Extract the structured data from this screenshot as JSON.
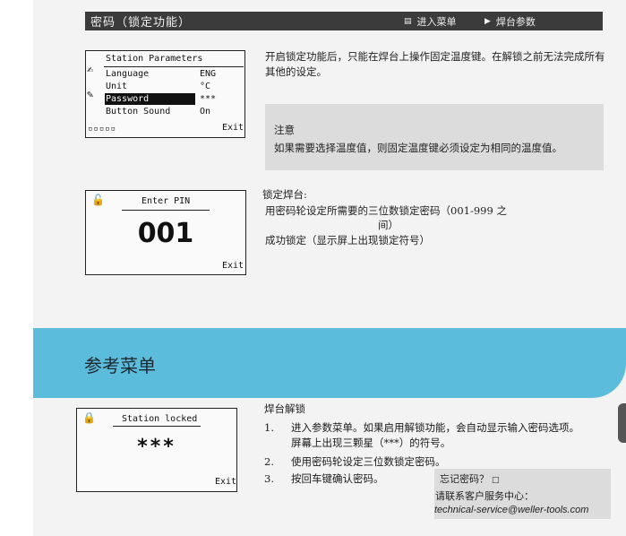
{
  "header": {
    "title": "密码（锁定功能）",
    "nav_enter": "进入菜单",
    "nav_params": "焊台参数"
  },
  "lcd1": {
    "title": "Station Parameters",
    "rows": [
      {
        "label": "Language",
        "value": "ENG"
      },
      {
        "label": "Unit",
        "value": "°C"
      },
      {
        "label": "Password",
        "value": "***"
      },
      {
        "label": "Button Sound",
        "value": "On"
      }
    ],
    "dots": "▫▫▫▫▫",
    "exit": "Exit"
  },
  "intro": "开启锁定功能后，只能在焊台上操作固定温度键。在解锁之前无法完成所有其他的设定。",
  "note": {
    "title": "注意",
    "body": "如果需要选择温度值，则固定温度键必须设定为相同的温度值。"
  },
  "lcd2": {
    "title": "Enter PIN",
    "value": "001",
    "exit": "Exit"
  },
  "lock": {
    "heading": "锁定焊台:",
    "line1": "用密码轮设定所需要的三位数锁定密码（001-999 之",
    "line2": "间）",
    "line3": "成功锁定（显示屏上出现锁定符号）"
  },
  "ref_menu": "参考菜单",
  "lcd3": {
    "title": "Station locked",
    "value": "***",
    "exit": "Exit"
  },
  "unlock": {
    "heading": "焊台解锁",
    "steps": [
      {
        "num": "1.",
        "text": "进入参数菜单。如果启用解锁功能，会自动显示输入密码选项。",
        "text2": "屏幕上出现三颗星（***）的符号。"
      },
      {
        "num": "2.",
        "text": "使用密码轮设定三位数锁定密码。"
      },
      {
        "num": "3.",
        "text": "按回车键确认密码。"
      }
    ]
  },
  "forgot": {
    "title": "忘记密码？",
    "line1": "请联系客户服务中心：",
    "email": "technical-service@weller-tools.com"
  }
}
